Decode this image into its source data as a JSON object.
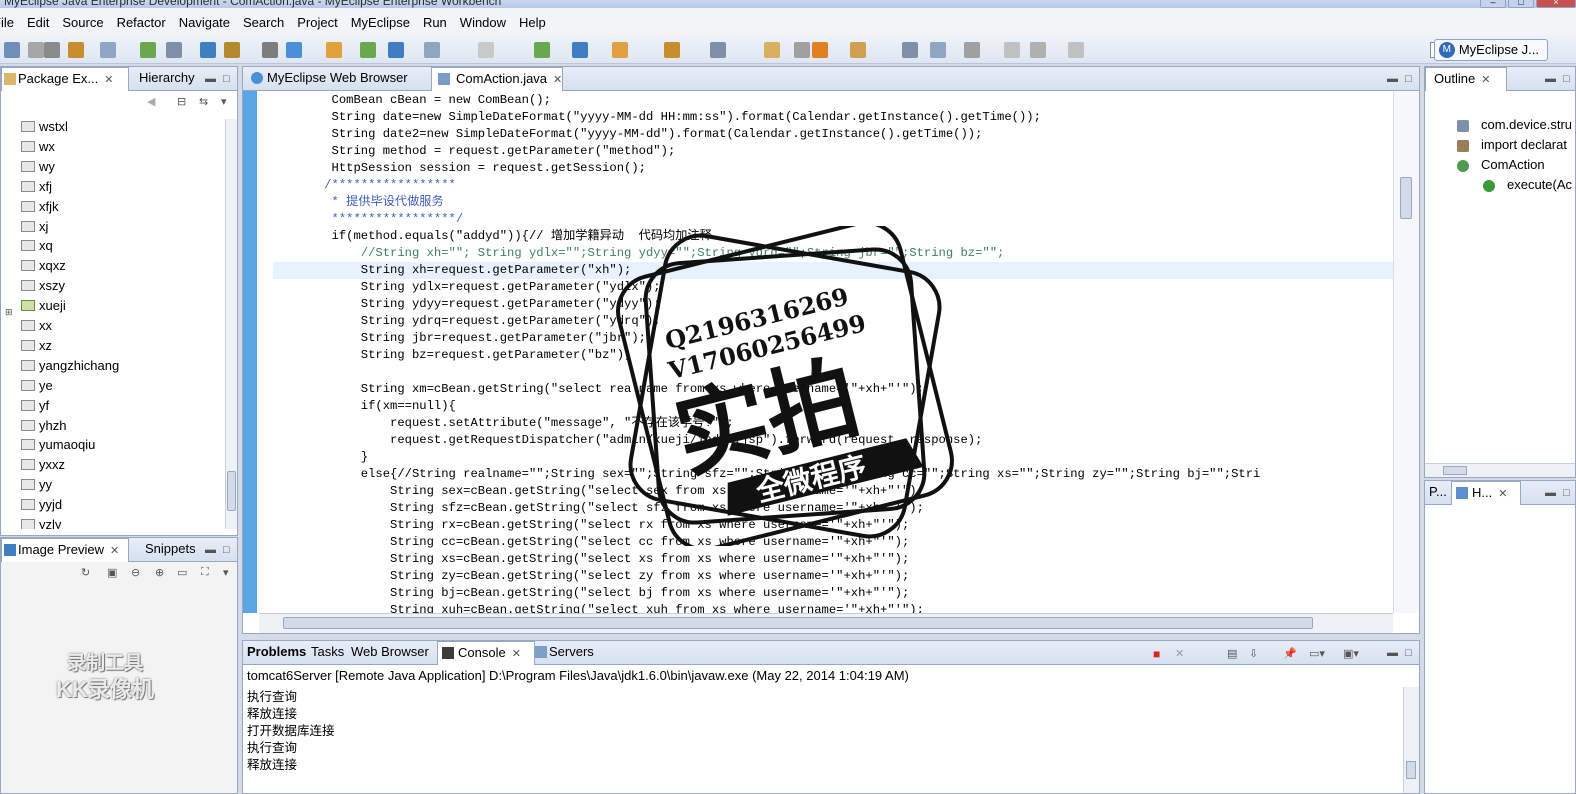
{
  "window": {
    "title": "MyEclipse Java Enterprise Development - ComAction.java - MyEclipse Enterprise Workbench"
  },
  "menu": [
    "File",
    "Edit",
    "Source",
    "Refactor",
    "Navigate",
    "Search",
    "Project",
    "MyEclipse",
    "Run",
    "Window",
    "Help"
  ],
  "toolbar": {
    "perspective_label": "MyEclipse J...",
    "perspective_icon": "myeclipse-perspective-icon"
  },
  "package_explorer": {
    "tabs": [
      "Package Ex...",
      "Hierarchy"
    ],
    "items": [
      {
        "label": "wstxl",
        "kind": "folder"
      },
      {
        "label": "wx",
        "kind": "folder"
      },
      {
        "label": "wy",
        "kind": "folder"
      },
      {
        "label": "xfj",
        "kind": "folder"
      },
      {
        "label": "xfjk",
        "kind": "folder"
      },
      {
        "label": "xj",
        "kind": "folder"
      },
      {
        "label": "xq",
        "kind": "folder"
      },
      {
        "label": "xqxz",
        "kind": "folder"
      },
      {
        "label": "xszy",
        "kind": "folder"
      },
      {
        "label": "xueji",
        "kind": "package"
      },
      {
        "label": "xx",
        "kind": "folder"
      },
      {
        "label": "xz",
        "kind": "folder"
      },
      {
        "label": "yangzhichang",
        "kind": "folder"
      },
      {
        "label": "ye",
        "kind": "folder"
      },
      {
        "label": "yf",
        "kind": "folder"
      },
      {
        "label": "yhzh",
        "kind": "folder"
      },
      {
        "label": "yumaoqiu",
        "kind": "folder"
      },
      {
        "label": "yxxz",
        "kind": "folder"
      },
      {
        "label": "yy",
        "kind": "folder"
      },
      {
        "label": "yyjd",
        "kind": "folder"
      },
      {
        "label": "yzly",
        "kind": "folder"
      }
    ]
  },
  "image_preview": {
    "tabs": [
      "Image Preview",
      "Snippets"
    ]
  },
  "editor": {
    "tabs": [
      "MyEclipse Web Browser",
      "ComAction.java"
    ],
    "lines": [
      {
        "text": "        ComBean cBean = new ComBean();",
        "style": "code"
      },
      {
        "text": "        String date=new SimpleDateFormat(\"yyyy-MM-dd HH:mm:ss\").format(Calendar.getInstance().getTime());",
        "style": "code"
      },
      {
        "text": "        String date2=new SimpleDateFormat(\"yyyy-MM-dd\").format(Calendar.getInstance().getTime());",
        "style": "code"
      },
      {
        "text": "        String method = request.getParameter(\"method\");",
        "style": "code"
      },
      {
        "text": "        HttpSession session = request.getSession();",
        "style": "code"
      },
      {
        "text": "       /*****************",
        "style": "javadoc"
      },
      {
        "text": "        * 提供毕设代做服务",
        "style": "javadoc"
      },
      {
        "text": "        *****************/",
        "style": "javadoc"
      },
      {
        "text": "        if(method.equals(\"addyd\")){// 增加学籍异动  代码均加注释",
        "style": "code"
      },
      {
        "text": "            //String xh=\"\"; String ydlx=\"\";String ydyy=\"\";String ydrq=\"\";String jbr=\"\";String bz=\"\";",
        "style": "comment"
      },
      {
        "text": "            String xh=request.getParameter(\"xh\");",
        "style": "hl"
      },
      {
        "text": "            String ydlx=request.getParameter(\"ydlx\");",
        "style": "code"
      },
      {
        "text": "            String ydyy=request.getParameter(\"ydyy\");",
        "style": "code"
      },
      {
        "text": "            String ydrq=request.getParameter(\"ydrq\");",
        "style": "code"
      },
      {
        "text": "            String jbr=request.getParameter(\"jbr\");",
        "style": "code"
      },
      {
        "text": "            String bz=request.getParameter(\"bz\");",
        "style": "code"
      },
      {
        "text": "",
        "style": "code"
      },
      {
        "text": "            String xm=cBean.getString(\"select realname from xs where username='\"+xh+\"'\");",
        "style": "code"
      },
      {
        "text": "            if(xm==null){",
        "style": "code"
      },
      {
        "text": "                request.setAttribute(\"message\", \"不存在该学号!\");",
        "style": "code"
      },
      {
        "text": "                request.getRequestDispatcher(\"admin/xueji/index.jsp\").forward(request, response);",
        "style": "code"
      },
      {
        "text": "            }",
        "style": "code"
      },
      {
        "text": "            else{//String realname=\"\";String sex=\"\";String sfz=\"\";String rx=\"\";String cc=\"\";String xs=\"\";String zy=\"\";String bj=\"\";Stri",
        "style": "code"
      },
      {
        "text": "                String sex=cBean.getString(\"select sex from xs where username='\"+xh+\"'\");",
        "style": "code"
      },
      {
        "text": "                String sfz=cBean.getString(\"select sfz from xs where username='\"+xh+\"'\");",
        "style": "code"
      },
      {
        "text": "                String rx=cBean.getString(\"select rx from xs where username='\"+xh+\"'\");",
        "style": "code"
      },
      {
        "text": "                String cc=cBean.getString(\"select cc from xs where username='\"+xh+\"'\");",
        "style": "code"
      },
      {
        "text": "                String xs=cBean.getString(\"select xs from xs where username='\"+xh+\"'\");",
        "style": "code"
      },
      {
        "text": "                String zy=cBean.getString(\"select zy from xs where username='\"+xh+\"'\");",
        "style": "code"
      },
      {
        "text": "                String bj=cBean.getString(\"select bj from xs where username='\"+xh+\"'\");",
        "style": "code"
      },
      {
        "text": "                String xuh=cBean.getString(\"select xuh from xs where username='\"+xh+\"'\");",
        "style": "code"
      }
    ]
  },
  "outline": {
    "tab": "Outline",
    "items": [
      {
        "label": "com.device.stru",
        "icon": "package-icon"
      },
      {
        "label": "import declarat",
        "icon": "imports-icon"
      },
      {
        "label": "ComAction",
        "icon": "class-icon"
      },
      {
        "label": "execute(Ac",
        "icon": "method-icon"
      }
    ]
  },
  "lower_right": {
    "tabs": [
      "P...",
      "H..."
    ]
  },
  "console": {
    "tabs": [
      "Problems",
      "Tasks",
      "Web Browser",
      "Console",
      "Servers"
    ],
    "header": "tomcat6Server [Remote Java Application] D:\\Program Files\\Java\\jdk1.6.0\\bin\\javaw.exe (May 22, 2014 1:04:19 AM)",
    "lines": [
      "执行查询",
      "释放连接",
      "打开数据库连接",
      "执行查询",
      "释放连接"
    ]
  },
  "watermark": {
    "qq": "Q2196316269",
    "wechat": "V17060256499",
    "big": "实拍",
    "banner": "全微程序",
    "recorder_line1": "录制工具",
    "recorder_line2": "KK录像机"
  }
}
